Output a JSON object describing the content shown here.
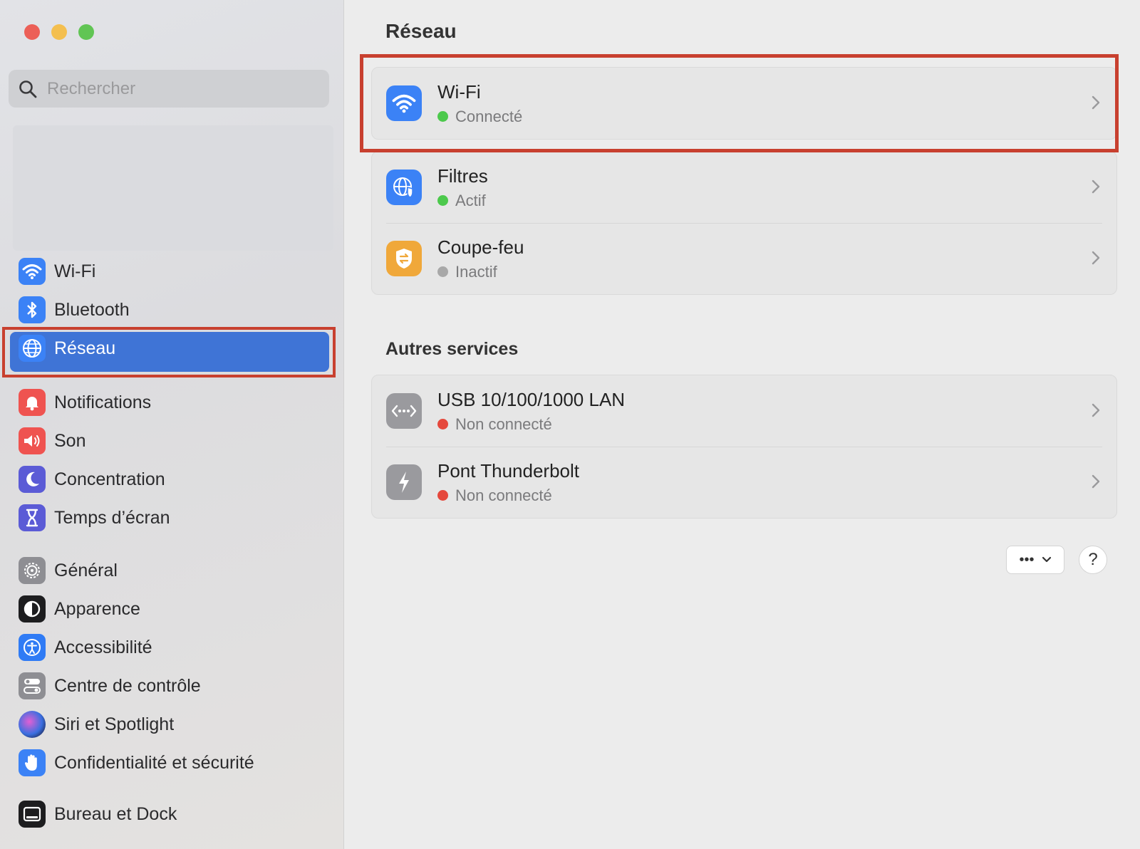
{
  "window": {
    "traffic_lights": [
      "#ec5f57",
      "#f4bf4f",
      "#61c554"
    ]
  },
  "sidebar": {
    "search": {
      "placeholder": "Rechercher"
    },
    "groups": [
      [
        {
          "label": "Wi-Fi",
          "icon": "wifi-icon",
          "color": "#3b82f6"
        },
        {
          "label": "Bluetooth",
          "icon": "bluetooth-icon",
          "color": "#3b82f6"
        },
        {
          "label": "Réseau",
          "icon": "globe-icon",
          "color": "#3b82f6",
          "active": true
        }
      ],
      [
        {
          "label": "Notifications",
          "icon": "bell-icon",
          "color": "#ef5350"
        },
        {
          "label": "Son",
          "icon": "speaker-icon",
          "color": "#ef5350"
        },
        {
          "label": "Concentration",
          "icon": "moon-icon",
          "color": "#5b5bd6"
        },
        {
          "label": "Temps d’écran",
          "icon": "hourglass-icon",
          "color": "#5b5bd6"
        }
      ],
      [
        {
          "label": "Général",
          "icon": "gear-icon",
          "color": "#8e8e93"
        },
        {
          "label": "Apparence",
          "icon": "appearance-icon",
          "color": "#1d1d1f"
        },
        {
          "label": "Accessibilité",
          "icon": "accessibility-icon",
          "color": "#2f7bf5"
        },
        {
          "label": "Centre de contrôle",
          "icon": "control-center-icon",
          "color": "#8e8e93"
        },
        {
          "label": "Siri et Spotlight",
          "icon": "siri-icon",
          "color": "#4b3b8f"
        },
        {
          "label": "Confidentialité et sécurité",
          "icon": "hand-icon",
          "color": "#3b82f6"
        }
      ],
      [
        {
          "label": "Bureau et Dock",
          "icon": "dock-icon",
          "color": "#1d1d1f"
        }
      ]
    ]
  },
  "main": {
    "title": "Réseau",
    "cards": [
      {
        "rows": [
          {
            "title": "Wi-Fi",
            "status": "Connecté",
            "status_color": "#4cc94c",
            "icon": "wifi-icon",
            "icon_color": "#3b82f6"
          }
        ]
      },
      {
        "rows": [
          {
            "title": "Filtres",
            "status": "Actif",
            "status_color": "#4cc94c",
            "icon": "globe-shield-icon",
            "icon_color": "#3b82f6"
          },
          {
            "title": "Coupe-feu",
            "status": "Inactif",
            "status_color": "#a8a8a8",
            "icon": "firewall-icon",
            "icon_color": "#f0a83a"
          }
        ]
      }
    ],
    "other_services_title": "Autres services",
    "other_services": [
      {
        "title": "USB 10/100/1000 LAN",
        "status": "Non connecté",
        "status_color": "#e5483c",
        "icon": "ethernet-icon",
        "icon_color": "#9a9a9e"
      },
      {
        "title": "Pont Thunderbolt",
        "status": "Non connecté",
        "status_color": "#e5483c",
        "icon": "thunderbolt-icon",
        "icon_color": "#9a9a9e"
      }
    ],
    "more_button": "•••",
    "help_button": "?"
  }
}
